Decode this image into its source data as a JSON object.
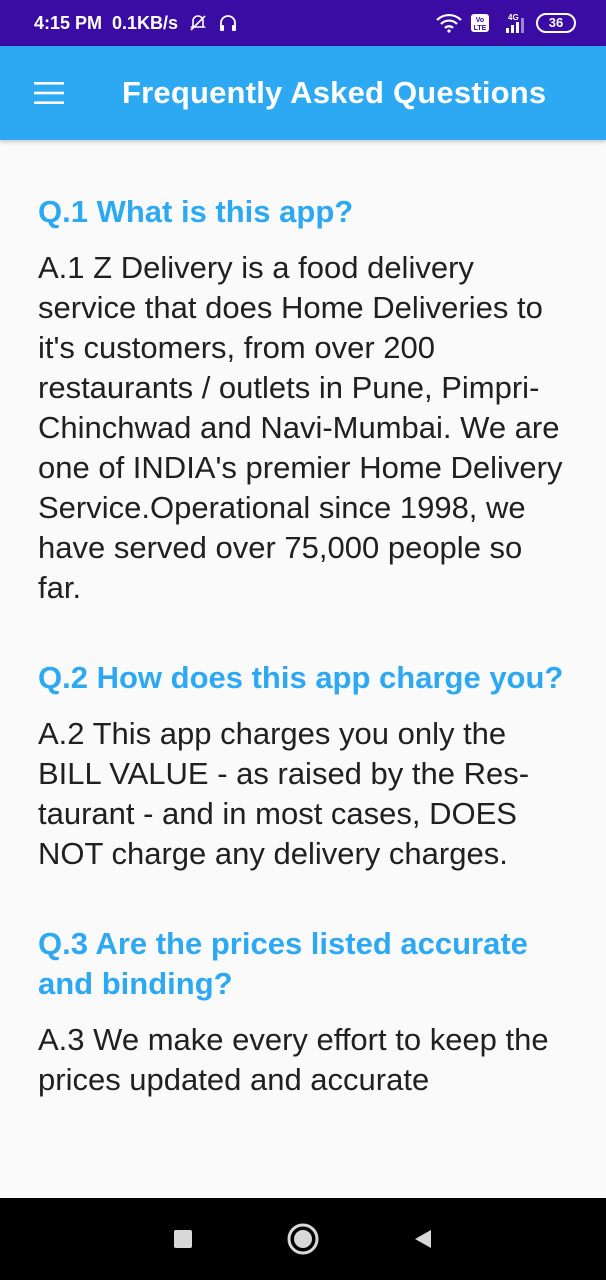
{
  "status_bar": {
    "time": "4:15 PM",
    "net_speed": "0.1KB/s",
    "battery": "36",
    "network_label": "4G",
    "volte_label": "Vo LTE",
    "icons": [
      "silent-bell-icon",
      "headset-icon",
      "wifi-icon",
      "signal-icon",
      "battery-icon"
    ]
  },
  "app_bar": {
    "title": "Frequently Asked Questions",
    "menu_icon": "hamburger-menu-icon",
    "background": "#2ca9f2"
  },
  "faq": [
    {
      "question": "Q.1 What is this app?",
      "answer": "A.1 Z Delivery is a food delivery service that does Home Deliveries to it's customers, from over 200 restaurants / outlets in Pune, Pimpri-Chinchwad and Navi-Mumbai. We are one of INDIA's premier Home Delivery Service.Operational since 1998, we have served over 75,000 people so far."
    },
    {
      "question": "Q.2 How does this app charge you?",
      "answer": "A.2 This app charges you only the BILL VALUE - as raised by the Res-taurant - and in most cases, DOES NOT charge any delivery charges."
    },
    {
      "question": "Q.3 Are the prices listed accurate and binding?",
      "answer": "A.3 We make every effort to keep the prices updated and accurate"
    }
  ],
  "nav_bar": {
    "icons": [
      "recents-square-icon",
      "home-circle-icon",
      "back-triangle-icon"
    ]
  },
  "colors": {
    "status_bar": "#3a0ca3",
    "accent": "#2ca9f2",
    "answer_text": "#202020"
  }
}
